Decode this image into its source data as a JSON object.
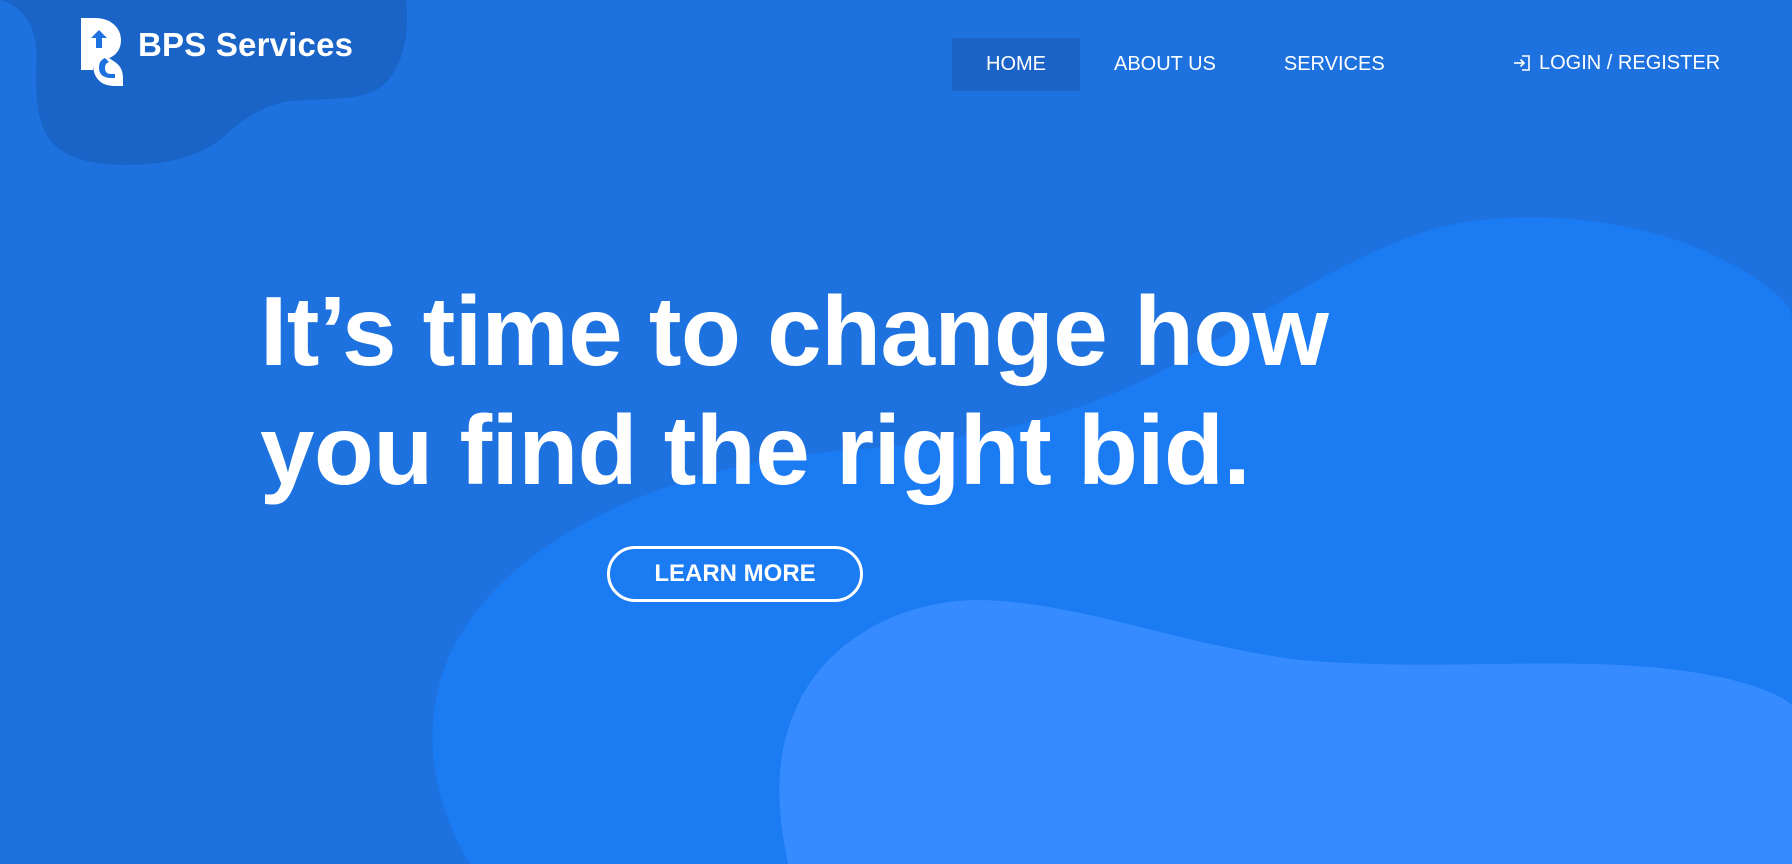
{
  "brand": {
    "name": "BPS Services",
    "logo_icon": "bps-logo-icon"
  },
  "nav": {
    "items": [
      {
        "label": "HOME",
        "active": true
      },
      {
        "label": "ABOUT US",
        "active": false
      },
      {
        "label": "SERVICES",
        "active": false
      }
    ]
  },
  "auth": {
    "label": "LOGIN / REGISTER",
    "icon": "login-icon"
  },
  "hero": {
    "headline_line1": "It’s time to change how",
    "headline_line2": "you find the right bid.",
    "cta_label": "LEARN MORE"
  },
  "colors": {
    "background": "#1d72e0",
    "nav_active": "#1c63c8",
    "blob_dark": "#1a64c8",
    "blob_mid": "#1b7bf2",
    "blob_light": "#368cff",
    "text": "#ffffff"
  }
}
